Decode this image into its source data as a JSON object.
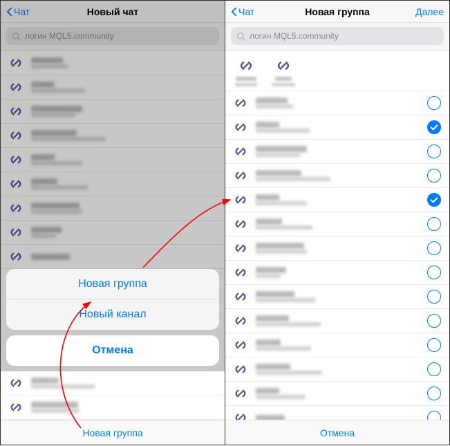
{
  "left": {
    "nav": {
      "back": "Чат",
      "title": "Новый чат"
    },
    "search": {
      "placeholder": "логин MQL5.community"
    },
    "contacts": [
      {
        "nameW": 46,
        "subW": 54
      },
      {
        "nameW": 34,
        "subW": 78
      },
      {
        "nameW": 74,
        "subW": 64
      },
      {
        "nameW": 66,
        "subW": 108
      },
      {
        "nameW": 34,
        "subW": 74
      },
      {
        "nameW": 38,
        "subW": 82
      },
      {
        "nameW": 70,
        "subW": 74
      },
      {
        "nameW": 44,
        "subW": 36
      },
      {
        "nameW": 56,
        "subW": 0
      }
    ],
    "sheet": {
      "new_group": "Новая группа",
      "new_channel": "Новый канал",
      "cancel": "Отмена"
    },
    "peek": [
      {
        "nameW": 40,
        "subW": 92
      },
      {
        "nameW": 68,
        "subW": 70
      }
    ],
    "bottom": "Новая группа"
  },
  "right": {
    "nav": {
      "back": "Чат",
      "title": "Новая группа",
      "next": "Далее"
    },
    "search": {
      "placeholder": "логин MQL5.community"
    },
    "selected": [
      {
        "w1": 30,
        "w2": 32
      },
      {
        "w1": 24,
        "w2": 34
      }
    ],
    "contacts": [
      {
        "nameW": 46,
        "subW": 54,
        "checked": false
      },
      {
        "nameW": 34,
        "subW": 78,
        "checked": true
      },
      {
        "nameW": 74,
        "subW": 64,
        "checked": false
      },
      {
        "nameW": 66,
        "subW": 108,
        "checked": false
      },
      {
        "nameW": 34,
        "subW": 74,
        "checked": true
      },
      {
        "nameW": 38,
        "subW": 82,
        "checked": false
      },
      {
        "nameW": 70,
        "subW": 74,
        "checked": false
      },
      {
        "nameW": 44,
        "subW": 36,
        "checked": false
      },
      {
        "nameW": 56,
        "subW": 86,
        "checked": false
      },
      {
        "nameW": 48,
        "subW": 94,
        "checked": false
      },
      {
        "nameW": 36,
        "subW": 80,
        "checked": false
      },
      {
        "nameW": 50,
        "subW": 96,
        "checked": false
      },
      {
        "nameW": 34,
        "subW": 72,
        "checked": false
      },
      {
        "nameW": 42,
        "subW": 0,
        "checked": false
      }
    ],
    "bottom": "Отмена"
  }
}
